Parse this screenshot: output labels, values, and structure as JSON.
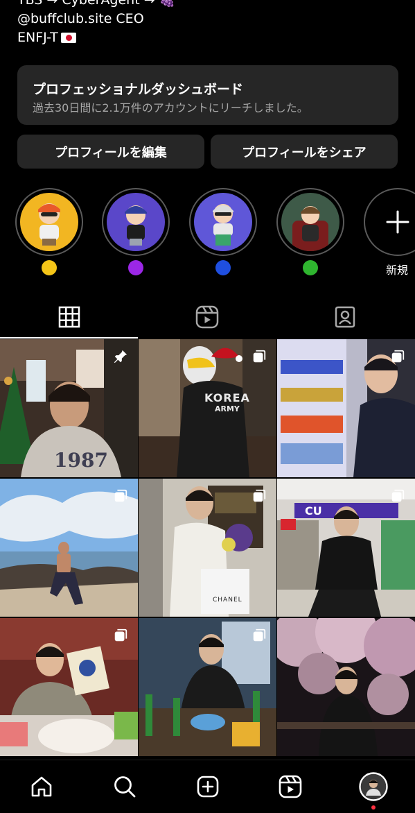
{
  "bio": {
    "line_partial": "TBS → CyberAgent → 🍇",
    "line2": "@buffclub.site CEO",
    "line3": "ENFJ-T",
    "line3_flag": "flag-japan-icon"
  },
  "dashboard": {
    "title": "プロフェッショナルダッシュボード",
    "subtitle": "過去30日間に2.1万件のアカウントにリーチしました。"
  },
  "actions": {
    "edit_label": "プロフィールを編集",
    "share_label": "プロフィールをシェア"
  },
  "highlights": {
    "items": [
      {
        "cover": "yellow",
        "dot_color": "#f5c518",
        "bg": "#f2b622"
      },
      {
        "cover": "purple",
        "dot_color": "#9b27e6",
        "bg": "#5a47c9"
      },
      {
        "cover": "blue",
        "dot_color": "#1f4fe0",
        "bg": "#5f57d8"
      },
      {
        "cover": "green",
        "dot_color": "#2fb52f",
        "bg": "#3e5a48"
      }
    ],
    "new_label": "新規"
  },
  "tabs": {
    "items": [
      "grid-icon",
      "reels-icon",
      "tagged-icon"
    ],
    "active": "grid-icon"
  },
  "posts": [
    {
      "type": "pinned",
      "icon": "pin-icon",
      "text": "1987"
    },
    {
      "type": "carousel",
      "icon": "carousel-icon",
      "text": "KOREA",
      "text2": "ARMY"
    },
    {
      "type": "carousel",
      "icon": "carousel-icon"
    },
    {
      "type": "carousel",
      "icon": "carousel-icon"
    },
    {
      "type": "carousel",
      "icon": "carousel-icon",
      "text": "CHANEL"
    },
    {
      "type": "carousel",
      "icon": "carousel-icon",
      "text": "CU"
    },
    {
      "type": "carousel",
      "icon": "carousel-icon"
    },
    {
      "type": "carousel",
      "icon": "carousel-icon"
    },
    {
      "type": "photo"
    }
  ],
  "bottom_nav": {
    "items": [
      "home-icon",
      "search-icon",
      "create-icon",
      "reels-icon",
      "profile-avatar"
    ],
    "notification_dot_color": "#ff3040"
  }
}
